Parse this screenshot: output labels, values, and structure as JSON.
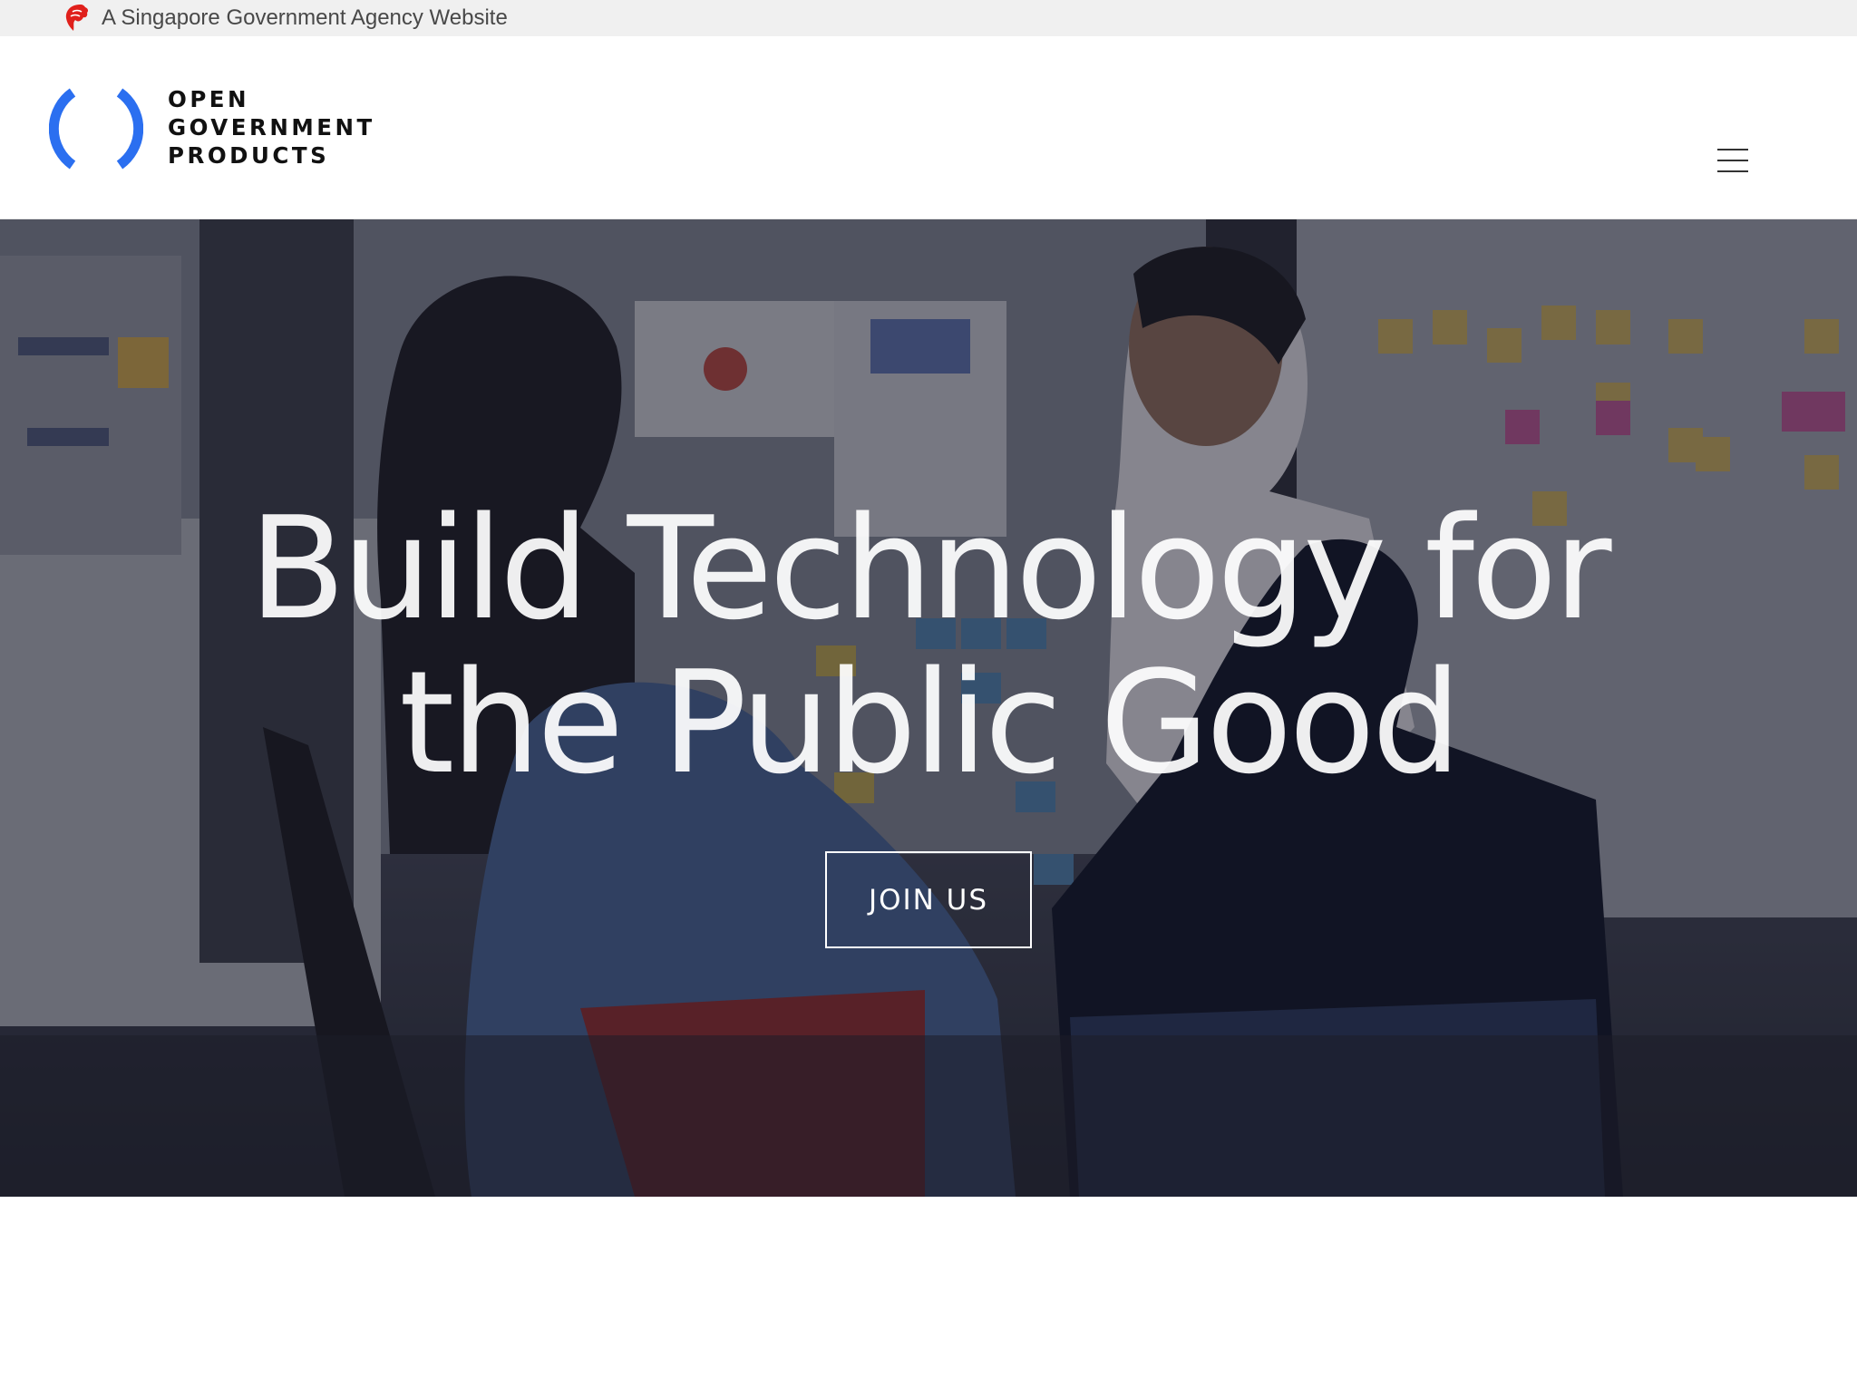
{
  "masthead": {
    "text": "A Singapore Government Agency Website",
    "icon": "lion-head-icon",
    "icon_color": "#e0201b"
  },
  "header": {
    "logo": {
      "lines": [
        "OPEN",
        "GOVERNMENT",
        "PRODUCTS"
      ],
      "mark_color": "#2b6ff0"
    },
    "menu_icon": "hamburger-menu-icon"
  },
  "hero": {
    "title_lines": [
      "Build Technology for",
      "the Public Good"
    ],
    "cta_label": "JOIN US"
  }
}
